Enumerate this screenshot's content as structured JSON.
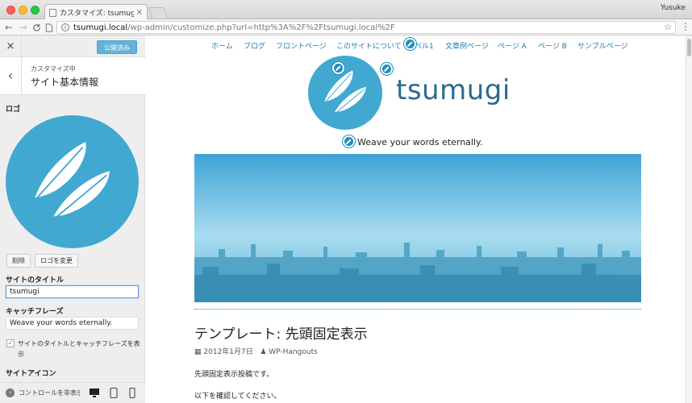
{
  "browser": {
    "tab_title": "カスタマイズ: tsumugi – Weave",
    "tab_close": "×",
    "user": "Yusuke",
    "url_host": "tsumugi.local",
    "url_path": "/wp-admin/customize.php?url=http%3A%2F%2Ftsumugi.local%2F",
    "back": "←",
    "forward": "→",
    "reload": "C",
    "star": "☆",
    "menu": "⋮",
    "info": "i"
  },
  "customizer": {
    "close": "×",
    "publish_label": "公開済み",
    "section_sub": "カスタマイズ中",
    "section_title": "サイト基本情報",
    "back": "‹",
    "logo_label": "ロゴ",
    "remove_label": "削除",
    "change_logo_label": "ロゴを変更",
    "site_title_label": "サイトのタイトル",
    "site_title_value": "tsumugi",
    "tagline_label": "キャッチフレーズ",
    "tagline_value": "Weave your words eternally.",
    "display_title_checked": true,
    "display_title_label": "サイトのタイトルとキャッチフレーズを表示",
    "check_mark": "✓",
    "site_icon_label": "サイトアイコン",
    "collapse_label": "コントロールを非表示",
    "collapse_icon": "‹"
  },
  "preview": {
    "nav": [
      "ホーム",
      "ブログ",
      "フロントページ",
      "このサイトについて",
      "ベル1",
      "文章例ページ",
      "ページ A",
      "ページ B",
      "サンプルページ"
    ],
    "site_title": "tsumugi",
    "tagline": "Weave your words eternally.",
    "post_title": "テンプレート: 先頭固定表示",
    "post_date": "2012年1月7日",
    "post_author": "WP-Hangouts",
    "date_icon": "▦",
    "author_icon": "♟",
    "body": [
      "先頭固定表示投稿です。",
      "以下を確認してください。"
    ]
  },
  "colors": {
    "accent": "#1e8cbe",
    "logo_blue": "#41a8d1",
    "publish": "#63b3d8"
  }
}
